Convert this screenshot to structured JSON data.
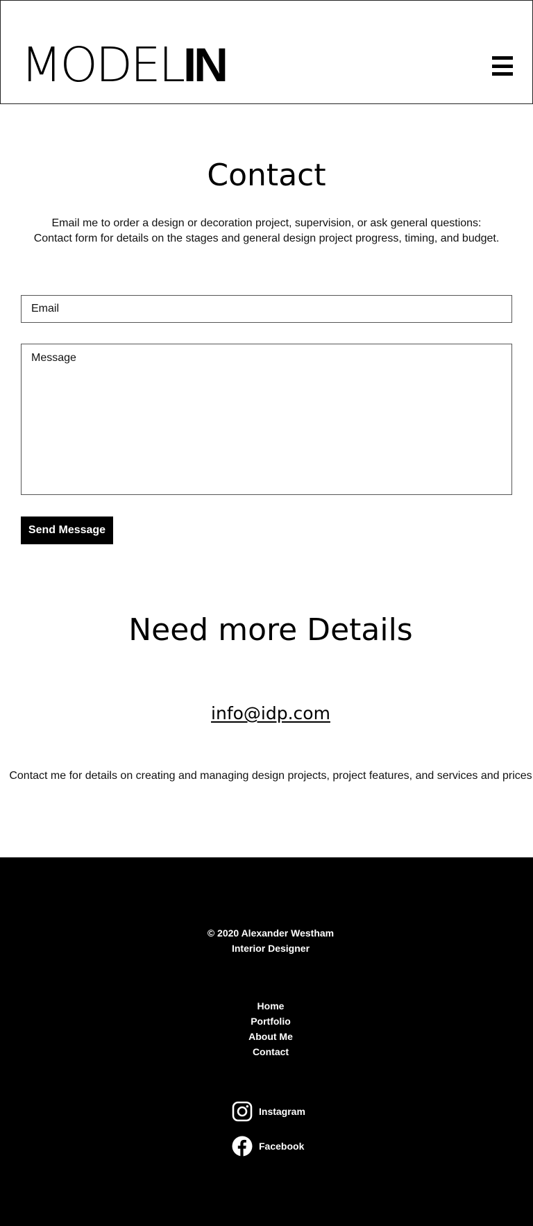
{
  "header": {
    "logo_light": "MODEL",
    "logo_bold": "IN",
    "menu_icon": "hamburger-menu-icon"
  },
  "contact": {
    "title": "Contact",
    "intro_line1": "Email me to order a design or decoration project, supervision, or ask general questions:",
    "intro_line2": "Contact form for details on the stages and general design project progress, timing, and budget.",
    "email_placeholder": "Email",
    "message_placeholder": "Message",
    "send_label": "Send Message"
  },
  "details": {
    "title": "Need more Details",
    "email": "info@idp.com",
    "text": "Contact me for details on creating and managing design projects, project features, and services and prices"
  },
  "footer": {
    "copyright": "© 2020 Alexander Westham",
    "role": "Interior Designer",
    "nav": [
      "Home",
      "Portfolio",
      "About Me",
      "Contact"
    ],
    "social": [
      {
        "label": "Instagram",
        "icon": "instagram-icon"
      },
      {
        "label": "Facebook",
        "icon": "facebook-icon"
      }
    ]
  },
  "colors": {
    "background": "#ffffff",
    "text": "#000000",
    "footer_bg": "#000000",
    "footer_text": "#ffffff"
  }
}
